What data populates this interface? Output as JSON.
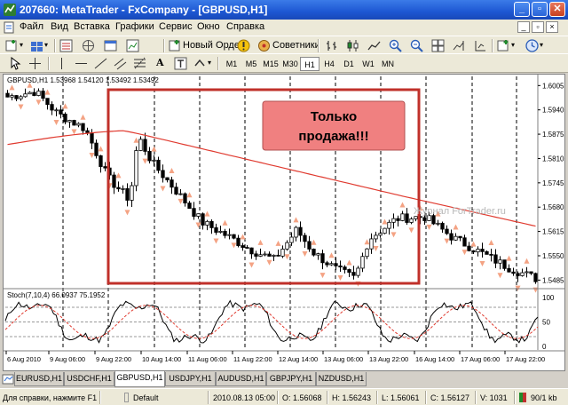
{
  "window": {
    "title": "207660: MetaTrader - FxCompany - [GBPUSD,H1]"
  },
  "menu": [
    "Файл",
    "Вид",
    "Вставка",
    "Графики",
    "Сервис",
    "Окно",
    "Справка"
  ],
  "toolbar": {
    "new_order": "Новый Ордер",
    "advisors": "Советники",
    "timeframes": [
      "M1",
      "M5",
      "M15",
      "M30",
      "H1",
      "H4",
      "D1",
      "W1",
      "MN"
    ],
    "active_timeframe": "H1",
    "text_tool": "A"
  },
  "chart": {
    "header": "GBPUSD,H1  1.53968 1.54120 1.53492 1.53492",
    "banner_line1": "Только",
    "banner_line2": "продажа!!!",
    "watermark": "Журнал ForTrader.ru",
    "price_ticks": [
      "1.60055",
      "1.59405",
      "1.58755",
      "1.58105",
      "1.57455",
      "1.56805",
      "1.56155",
      "1.55505",
      "1.54855"
    ],
    "price_values": [
      1.60055,
      1.59405,
      1.58755,
      1.58105,
      1.57455,
      1.56805,
      1.56155,
      1.55505,
      1.54855
    ],
    "stoch_header": "Stoch(7,10,4) 66.0937 75.1952",
    "stoch_ticks": [
      "100",
      "50",
      "0"
    ],
    "time_ticks": [
      "6 Aug 2010",
      "9 Aug 06:00",
      "9 Aug 22:00",
      "10 Aug 14:00",
      "11 Aug 06:00",
      "11 Aug 22:00",
      "12 Aug 14:00",
      "13 Aug 06:00",
      "13 Aug 22:00",
      "16 Aug 14:00",
      "17 Aug 06:00",
      "17 Aug 22:00"
    ],
    "colors": {
      "bull_candle": "#ffffff",
      "bear_candle": "#000000",
      "moving_average": "#e03a2f",
      "fractal_up": "#f4a384",
      "fractal_down": "#f4a384",
      "frame": "#c0302a",
      "banner_bg": "#f08080",
      "stoch_main": "#000000",
      "stoch_signal": "#e03a2f"
    }
  },
  "tabs": [
    "EURUSD,H1",
    "USDCHF,H1",
    "GBPUSD,H1",
    "USDJPY,H1",
    "AUDUSD,H1",
    "GBPJPY,H1",
    "NZDUSD,H1"
  ],
  "active_tab": "GBPUSD,H1",
  "status": {
    "help": "Для справки, нажмите F1",
    "profile": "Default",
    "datetime": "2010.08.13 05:00",
    "open": "O: 1.56068",
    "high": "H: 1.56243",
    "low": "L: 1.56061",
    "close": "C: 1.56127",
    "volume": "V: 1031",
    "traffic": "90/1 kb"
  }
}
